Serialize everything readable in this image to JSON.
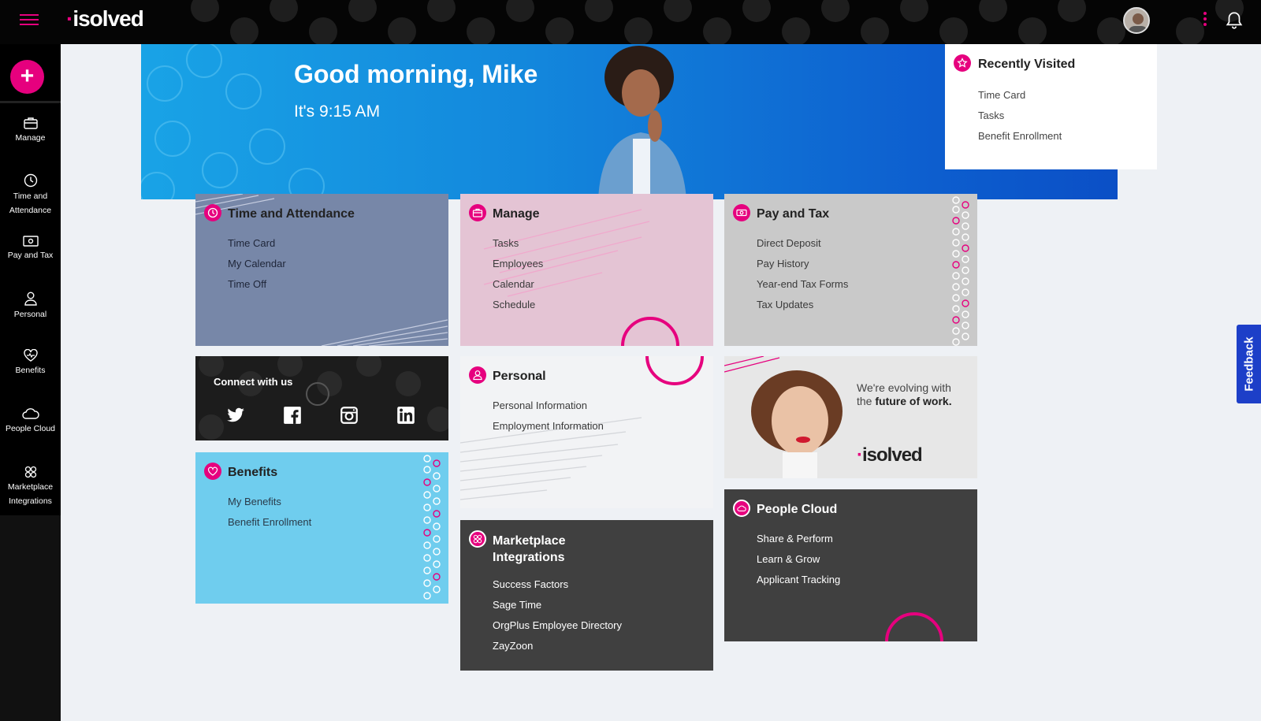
{
  "app": {
    "logo": "isolved"
  },
  "topbar": {
    "menu_icon": "hamburger-icon",
    "more_icon": "kebab-icon",
    "notifications_icon": "bell-icon"
  },
  "rail": {
    "add_label": "+",
    "items": [
      {
        "label": "Manage",
        "icon": "briefcase-icon"
      },
      {
        "label": "Time and Attendance",
        "icon": "clock-icon"
      },
      {
        "label": "Pay and Tax",
        "icon": "money-icon"
      },
      {
        "label": "Personal",
        "icon": "person-icon"
      },
      {
        "label": "Benefits",
        "icon": "heart-icon"
      },
      {
        "label": "People Cloud",
        "icon": "cloud-icon"
      },
      {
        "label": "Marketplace Integrations",
        "icon": "marketplace-icon"
      }
    ]
  },
  "hero": {
    "greeting": "Good morning, Mike",
    "time": "It's 9:15 AM"
  },
  "recent": {
    "title": "Recently Visited",
    "items": [
      "Time Card",
      "Tasks",
      "Benefit Enrollment"
    ]
  },
  "tiles": {
    "time": {
      "title": "Time and Attendance",
      "items": [
        "Time Card",
        "My Calendar",
        "Time Off"
      ]
    },
    "manage": {
      "title": "Manage",
      "items": [
        "Tasks",
        "Employees",
        "Calendar",
        "Schedule"
      ]
    },
    "pay": {
      "title": "Pay and Tax",
      "items": [
        "Direct Deposit",
        "Pay History",
        "Year-end Tax Forms",
        "Tax Updates"
      ]
    },
    "connect": {
      "title": "Connect with us",
      "social": [
        "twitter-icon",
        "facebook-icon",
        "instagram-icon",
        "linkedin-icon"
      ]
    },
    "benefits": {
      "title": "Benefits",
      "items": [
        "My Benefits",
        "Benefit Enrollment"
      ]
    },
    "personal": {
      "title": "Personal",
      "items": [
        "Personal Information",
        "Employment Information"
      ]
    },
    "market": {
      "title_line1": "Marketplace",
      "title_line2": "Integrations",
      "items": [
        "Success Factors",
        "Sage Time",
        "OrgPlus Employee Directory",
        "ZayZoon"
      ]
    },
    "ad": {
      "tagline_1": "We're evolving with",
      "tagline_2": "the ",
      "tagline_bold": "future of work.",
      "logo": "isolved"
    },
    "people": {
      "title": "People Cloud",
      "items": [
        "Share & Perform",
        "Learn & Grow",
        "Applicant Tracking"
      ]
    }
  },
  "feedback": {
    "label": "Feedback"
  },
  "colors": {
    "brand_pink": "#e6007e",
    "hero_blue": "#1387dc",
    "feedback_blue": "#1d3fc8"
  }
}
